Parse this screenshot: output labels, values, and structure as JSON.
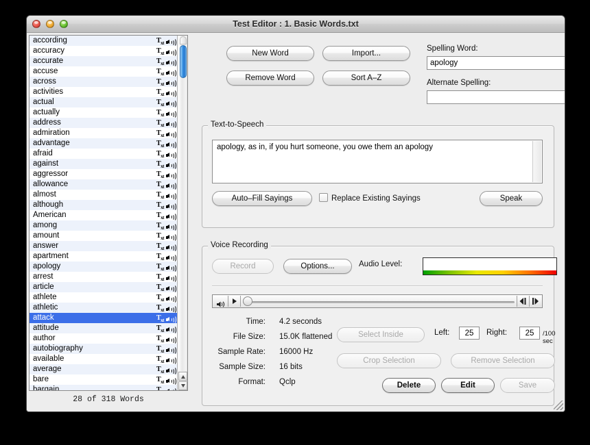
{
  "window": {
    "title": "Test Editor : 1. Basic Words.txt",
    "controls": {
      "close": "close",
      "minimize": "minimize",
      "zoom": "zoom"
    }
  },
  "word_list": {
    "status": "28  of  318  Words",
    "selected_index": 27,
    "row_icon_text": "T",
    "row_icon_sub": "xt",
    "items": [
      "according",
      "accuracy",
      "accurate",
      "accuse",
      "across",
      "activities",
      "actual",
      "actually",
      "address",
      "admiration",
      "advantage",
      "afraid",
      "against",
      "aggressor",
      "allowance",
      "almost",
      "although",
      "American",
      "among",
      "amount",
      "answer",
      "apartment",
      "apology",
      "arrest",
      "article",
      "athlete",
      "athletic",
      "attack",
      "attitude",
      "author",
      "autobiography",
      "available",
      "average",
      "bare",
      "bargain"
    ]
  },
  "toolbar": {
    "new_word": "New Word",
    "remove_word": "Remove Word",
    "import": "Import...",
    "sort": "Sort A–Z"
  },
  "spelling": {
    "word_label": "Spelling Word:",
    "word_value": "apology",
    "alternate_label": "Alternate Spelling:",
    "alternate_value": ""
  },
  "tts": {
    "title": "Text-to-Speech",
    "sayings": "apology, as in, if you hurt someone, you owe them an apology",
    "auto_fill": "Auto–Fill Sayings",
    "replace_existing": "Replace Existing Sayings",
    "replace_checked": false,
    "speak": "Speak"
  },
  "voice": {
    "title": "Voice Recording",
    "record": "Record",
    "record_enabled": false,
    "options": "Options...",
    "audio_level_label": "Audio Level:",
    "meter_colors": [
      "#00a000",
      "#7ec400",
      "#e8e800",
      "#ffd000",
      "#ff7000",
      "#ee0000"
    ],
    "stats": [
      {
        "label": "Time:",
        "value": "4.2 seconds"
      },
      {
        "label": "File Size:",
        "value": "15.0K flattened"
      },
      {
        "label": "Sample Rate:",
        "value": "16000 Hz"
      },
      {
        "label": "Sample Size:",
        "value": "16 bits"
      },
      {
        "label": "Format:",
        "value": "Qclp"
      }
    ],
    "select_inside": "Select Inside",
    "crop_selection": "Crop Selection",
    "remove_selection": "Remove Selection",
    "left_label": "Left:",
    "left_value": "25",
    "right_label": "Right:",
    "right_value": "25",
    "units": "/100 sec",
    "delete": "Delete",
    "edit": "Edit",
    "save": "Save"
  }
}
